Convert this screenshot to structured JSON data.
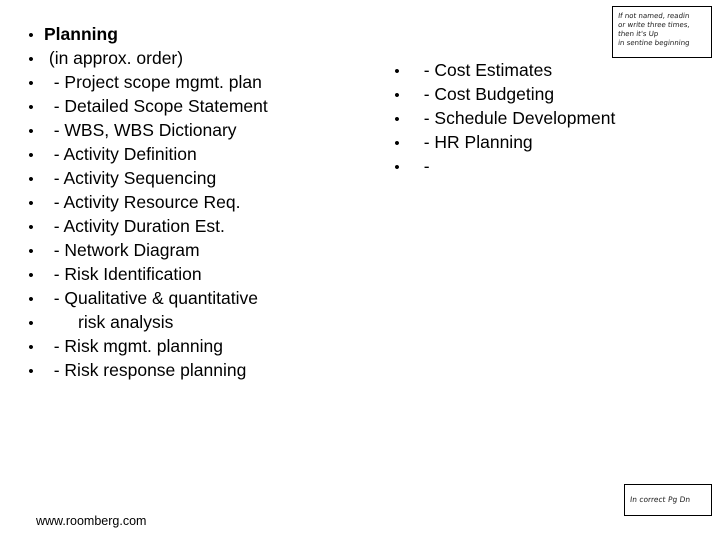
{
  "slide": {
    "left_column": {
      "items": [
        {
          "bullet": "•",
          "text": "Planning",
          "bold": true
        },
        {
          "bullet": "•",
          "text": " (in approx. order)",
          "bold": false
        },
        {
          "bullet": "•",
          "text": "  - Project scope mgmt. plan",
          "bold": false
        },
        {
          "bullet": "•",
          "text": "  - Detailed Scope Statement",
          "bold": false
        },
        {
          "bullet": "•",
          "text": "  - WBS, WBS Dictionary",
          "bold": false
        },
        {
          "bullet": "•",
          "text": "  - Activity Definition",
          "bold": false
        },
        {
          "bullet": "•",
          "text": "  - Activity Sequencing",
          "bold": false
        },
        {
          "bullet": "•",
          "text": "  - Activity Resource Req.",
          "bold": false
        },
        {
          "bullet": "•",
          "text": "  - Activity Duration Est.",
          "bold": false
        },
        {
          "bullet": "•",
          "text": "  - Network Diagram",
          "bold": false
        },
        {
          "bullet": "•",
          "text": "  - Risk Identification",
          "bold": false
        },
        {
          "bullet": "•",
          "text": "  - Qualitative & quantitative",
          "bold": false
        },
        {
          "bullet": "•",
          "text": "       risk analysis",
          "bold": false
        },
        {
          "bullet": "•",
          "text": "  - Risk mgmt. planning",
          "bold": false
        },
        {
          "bullet": "•",
          "text": "  - Risk response planning",
          "bold": false
        }
      ]
    },
    "right_column": {
      "items": [
        {
          "bullet": "•",
          "text": "  - Cost Estimates"
        },
        {
          "bullet": "•",
          "text": "  - Cost Budgeting"
        },
        {
          "bullet": "•",
          "text": "  - Schedule Development"
        },
        {
          "bullet": "•",
          "text": "  - HR Planning"
        },
        {
          "bullet": "•",
          "text": "  -"
        }
      ]
    },
    "note_top": {
      "lines": [
        "If not named, readin",
        "or write three times,",
        "then it's Up",
        "in sentine beginning"
      ]
    },
    "note_bottom": {
      "lines": [
        "In correct Pg Dn"
      ]
    },
    "footer": {
      "url": "www.roomberg.com"
    }
  }
}
